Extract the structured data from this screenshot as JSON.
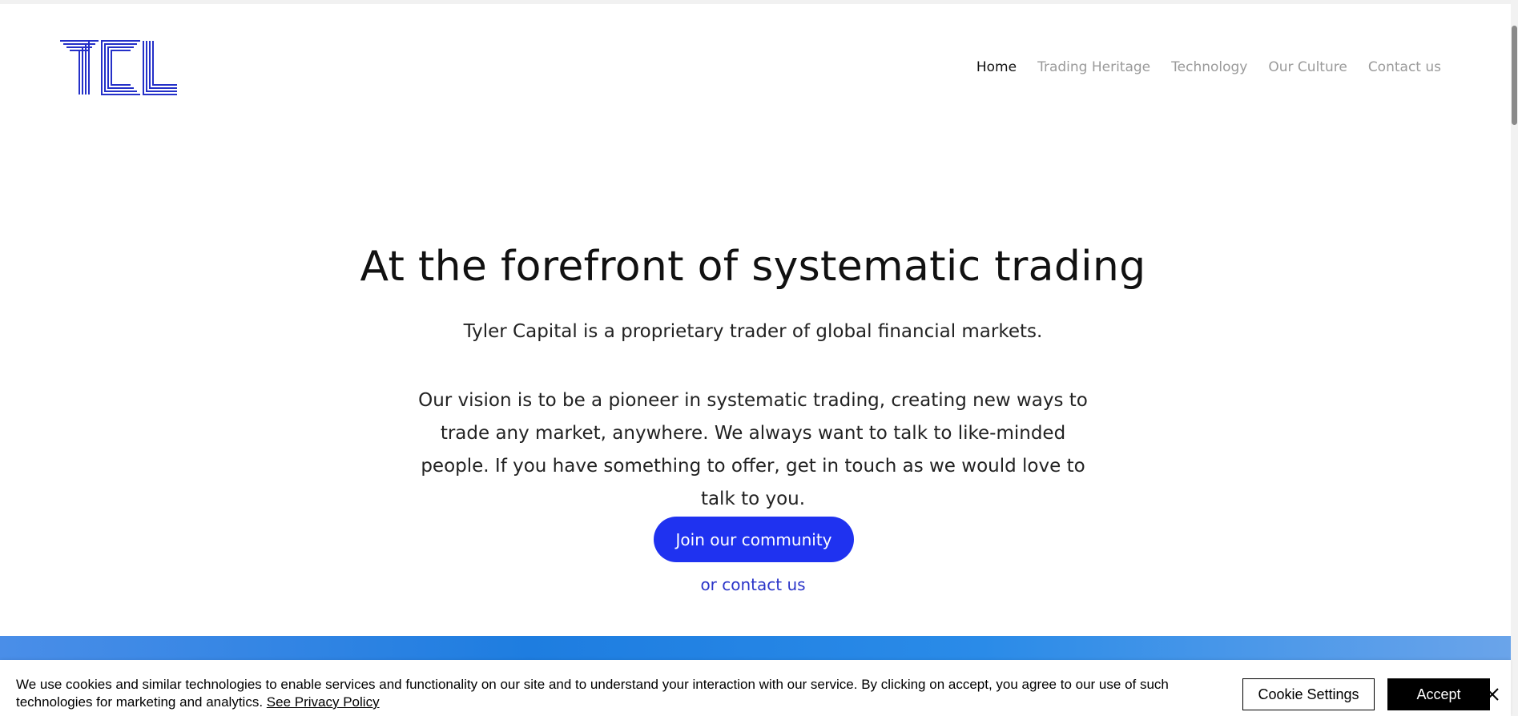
{
  "colors": {
    "brand_blue": "#1f32f0",
    "link_blue": "#2b35c9",
    "nav_inactive": "#9a9a9a"
  },
  "logo": {
    "icon": "tcl-logo-icon"
  },
  "nav": {
    "items": [
      {
        "label": "Home",
        "active": true
      },
      {
        "label": "Trading Heritage"
      },
      {
        "label": "Technology"
      },
      {
        "label": "Our Culture"
      },
      {
        "label": "Contact us"
      }
    ]
  },
  "hero": {
    "title": "At the forefront of systematic trading",
    "subtitle": "Tyler Capital is a proprietary trader of global financial markets.",
    "body": "Our vision is to be a pioneer in systematic trading, creating new ways to trade any market, anywhere. We always want to talk to like-minded people. If you have something to offer, get in touch as we would love to talk to you.",
    "cta_label": "Join our community",
    "secondary_link": "or contact us"
  },
  "cookie": {
    "message": "We use cookies and similar technologies to enable services and functionality on our site and to understand your interaction with our service. By clicking on accept, you agree to our use of such technologies for marketing and analytics.",
    "policy_link": "See Privacy Policy",
    "settings_label": "Cookie Settings",
    "accept_label": "Accept",
    "close_icon": "close-icon"
  }
}
